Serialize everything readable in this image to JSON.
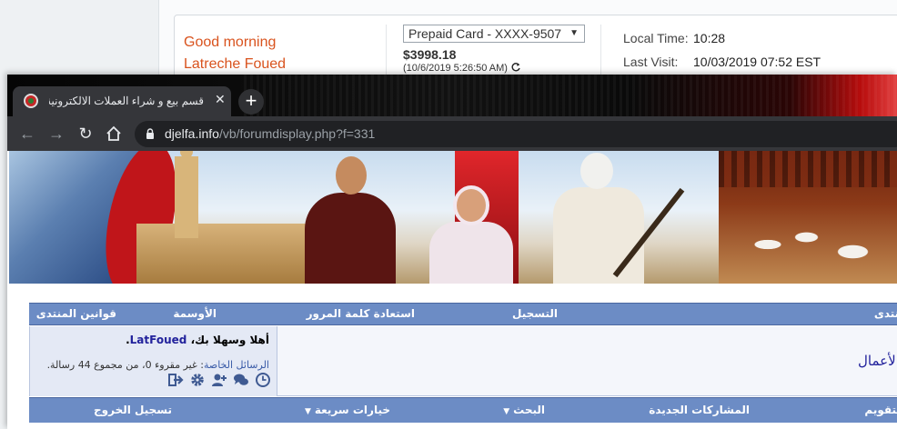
{
  "bank": {
    "greeting": "Good morning",
    "user_name": "Latreche Foued",
    "account_selected": "Prepaid Card - XXXX-9507",
    "balance": "$3998.18",
    "balance_time": "(10/6/2019 5:26:50 AM)",
    "local_time_label": "Local Time:",
    "local_time_value": "10:28",
    "last_visit_label": "Last Visit:",
    "last_visit_value": "10/03/2019 07:52 EST"
  },
  "browser": {
    "tab_title": "قسم بيع و شراء العملات الالكترونية",
    "url_host": "djelfa.info",
    "url_path": "/vb/forumdisplay.php?f=331"
  },
  "forum": {
    "nav": {
      "rules": "قوانين المنتدى",
      "medals": "الأوسمة",
      "recover_password": "استعادة كلمة المرور",
      "register": "التسجيل",
      "forum": "منتدى"
    },
    "welcome": {
      "prefix": "أهلا وسهلا بك،",
      "username": "LatFoued",
      "suffix": ".",
      "pm_label": "الرسائل الخاصة",
      "pm_text": ": غير مقروء 0، من مجموع 44 رسالة."
    },
    "section_title": "لأعمال",
    "subnav": {
      "logout": "تسجيل الخروج",
      "quick_options": "خيارات سريعة",
      "search": "البحث",
      "new_posts": "المشاركات الجديدة",
      "calendar": "التقويم"
    },
    "user_icons": [
      "clock-icon",
      "chat-icon",
      "add-user-icon",
      "gear-icon",
      "logout-icon"
    ]
  }
}
